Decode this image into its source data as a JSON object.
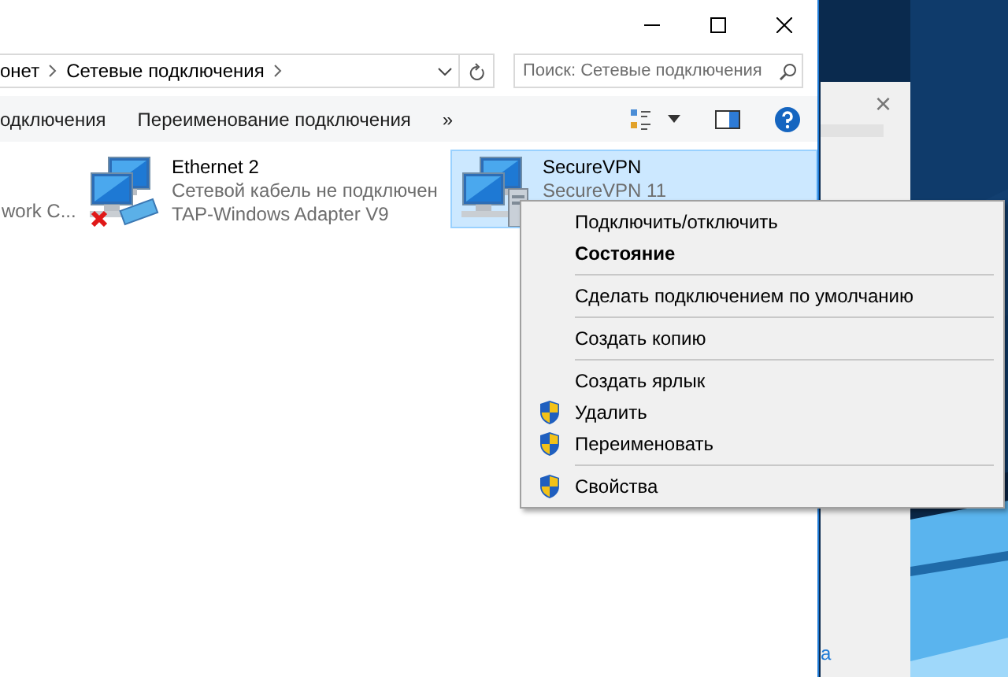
{
  "address": {
    "crumbs": [
      "онет",
      "Сетевые подключения"
    ]
  },
  "search": {
    "placeholder": "Поиск: Сетевые подключения"
  },
  "toolbar": {
    "commands": [
      "одключения",
      "Переименование подключения"
    ],
    "more": "»"
  },
  "connections": [
    {
      "kind": "cut",
      "selected": false,
      "lines": [
        "work C..."
      ]
    },
    {
      "kind": "ethernet-disconnected",
      "selected": false,
      "lines": [
        "Ethernet 2",
        "Сетевой кабель не подключен",
        "TAP-Windows Adapter V9"
      ]
    },
    {
      "kind": "vpn",
      "selected": true,
      "lines": [
        "SecureVPN",
        "SecureVPN  11"
      ]
    }
  ],
  "context_menu": [
    {
      "kind": "item",
      "label": "Подключить/отключить",
      "bold": false,
      "shield": false
    },
    {
      "kind": "item",
      "label": "Состояние",
      "bold": true,
      "shield": false
    },
    {
      "kind": "separator"
    },
    {
      "kind": "item",
      "label": "Сделать подключением по умолчанию",
      "bold": false,
      "shield": false
    },
    {
      "kind": "separator"
    },
    {
      "kind": "item",
      "label": "Создать копию",
      "bold": false,
      "shield": false
    },
    {
      "kind": "separator"
    },
    {
      "kind": "item",
      "label": "Создать ярлык",
      "bold": false,
      "shield": false
    },
    {
      "kind": "item",
      "label": "Удалить",
      "bold": false,
      "shield": true
    },
    {
      "kind": "item",
      "label": "Переименовать",
      "bold": false,
      "shield": true
    },
    {
      "kind": "separator"
    },
    {
      "kind": "item",
      "label": "Свойства",
      "bold": false,
      "shield": true
    }
  ],
  "background_window": {
    "close": "×",
    "fragment": "а"
  }
}
